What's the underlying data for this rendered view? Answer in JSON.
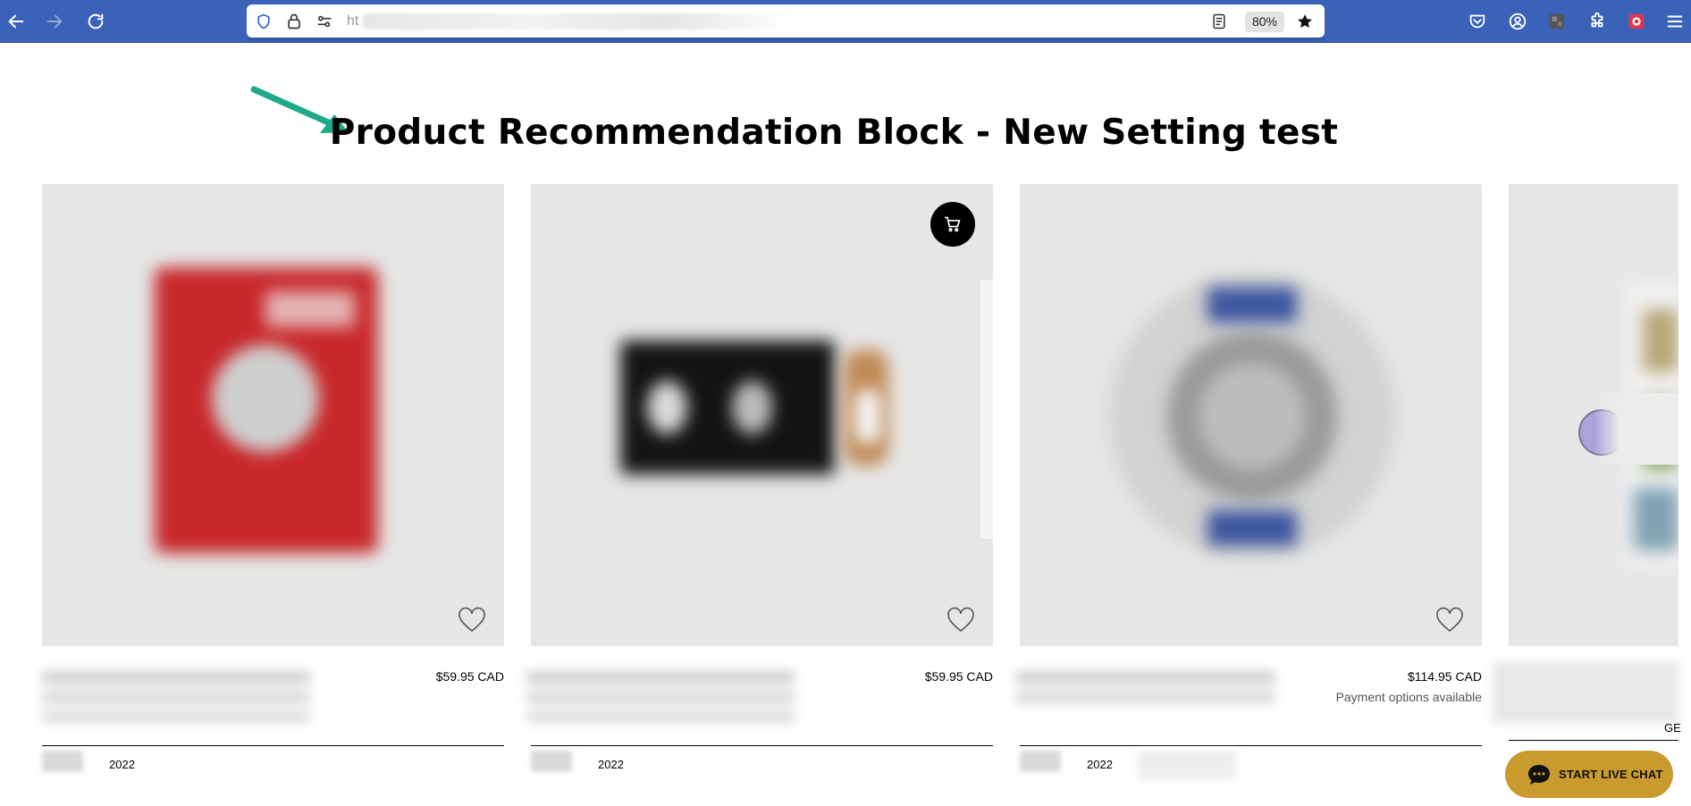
{
  "browser": {
    "url_prefix": "ht",
    "zoom": "80%",
    "icons": {
      "back": "arrow-left-icon",
      "forward": "arrow-right-icon",
      "reload": "reload-icon",
      "shield": "shield-icon",
      "lock": "lock-icon",
      "permissions": "permissions-icon",
      "reader": "reader-view-icon",
      "bookmark": "star-icon",
      "pocket": "pocket-icon",
      "account": "account-icon",
      "extension_image": "extension-thumbnail-icon",
      "extensions": "puzzle-icon",
      "addon": "addon-badge-icon",
      "menu": "hamburger-menu-icon"
    },
    "toolbar_color": "#3a62b8"
  },
  "page": {
    "title": "Product Recommendation Block - New Setting test",
    "annotation_arrow_color": "#1fa88a"
  },
  "products": [
    {
      "price": "$59.95 CAD",
      "year": "2022",
      "payment": "",
      "has_cart_button": false
    },
    {
      "price": "$59.95 CAD",
      "year": "2022",
      "payment": "",
      "has_cart_button": true
    },
    {
      "price": "$114.95 CAD",
      "year": "2022",
      "payment": "Payment options available",
      "has_cart_button": false
    }
  ],
  "partial_card": {
    "trailing_text": "GE"
  },
  "chat": {
    "label": "START LIVE CHAT",
    "color": "#c99a2e"
  }
}
